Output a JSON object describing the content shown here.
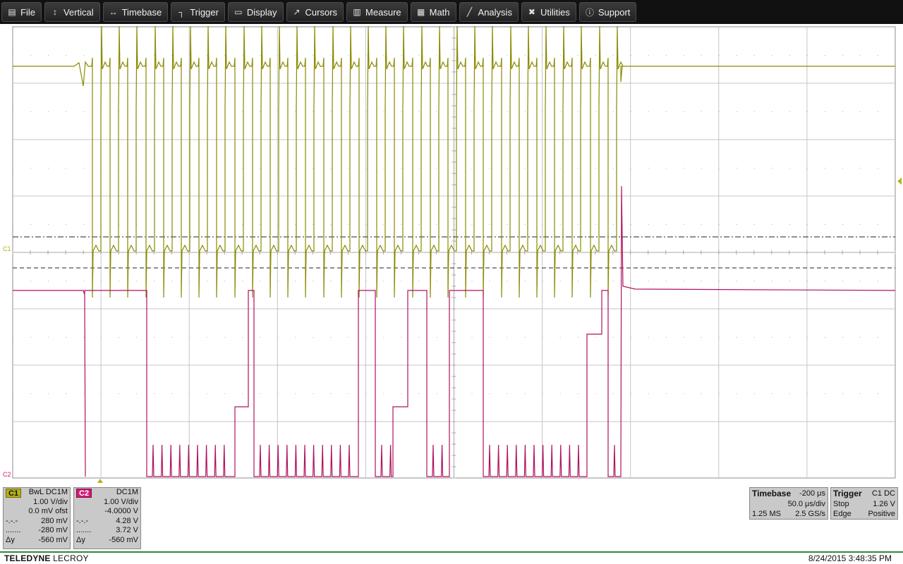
{
  "menu": [
    {
      "label": "File",
      "icon": "file-icon",
      "glyph": "▤"
    },
    {
      "label": "Vertical",
      "icon": "vertical-icon",
      "glyph": "↕"
    },
    {
      "label": "Timebase",
      "icon": "timebase-icon",
      "glyph": "↔"
    },
    {
      "label": "Trigger",
      "icon": "trigger-icon",
      "glyph": "┐"
    },
    {
      "label": "Display",
      "icon": "display-icon",
      "glyph": "▭"
    },
    {
      "label": "Cursors",
      "icon": "cursors-icon",
      "glyph": "↗"
    },
    {
      "label": "Measure",
      "icon": "measure-icon",
      "glyph": "▥"
    },
    {
      "label": "Math",
      "icon": "math-icon",
      "glyph": "▦"
    },
    {
      "label": "Analysis",
      "icon": "analysis-icon",
      "glyph": "╱"
    },
    {
      "label": "Utilities",
      "icon": "utilities-icon",
      "glyph": "✖"
    },
    {
      "label": "Support",
      "icon": "support-icon",
      "glyph": "ⓘ"
    }
  ],
  "markers": {
    "c1": "C1",
    "c2": "C2"
  },
  "channel1": {
    "tag": "C1",
    "coupling": "BwL  DC1M",
    "volts_div": "1.00 V/div",
    "offset": "0.0 mV ofst",
    "cursor1_sym": "-.-.-",
    "cursor1": "280 mV",
    "cursor2_sym": ".......",
    "cursor2": "-280 mV",
    "delta_label": "Δy",
    "delta": "-560 mV",
    "color": "#b5b016"
  },
  "channel2": {
    "tag": "C2",
    "coupling": "DC1M",
    "volts_div": "1.00 V/div",
    "offset": "-4.0000 V",
    "cursor1_sym": "-.-.-",
    "cursor1": "4.28 V",
    "cursor2_sym": ".......",
    "cursor2": "3.72 V",
    "delta_label": "Δy",
    "delta": "-560 mV",
    "color": "#d6187a"
  },
  "timebase": {
    "label": "Timebase",
    "delay": "-200 μs",
    "per_div": "50.0 μs/div",
    "samples": "1.25 MS",
    "rate": "2.5 GS/s"
  },
  "trigger": {
    "label": "Trigger",
    "source": "C1  DC",
    "mode": "Stop",
    "level": "1.26 V",
    "type": "Edge",
    "slope": "Positive"
  },
  "footer": {
    "brand_bold": "TELEDYNE",
    "brand_rest": " LECROY",
    "datetime": "8/24/2015 3:48:35 PM"
  },
  "colors": {
    "c1": "#8a8a00",
    "c2": "#b0125f",
    "grid": "#9a9a9a",
    "menubar": "#111111"
  }
}
